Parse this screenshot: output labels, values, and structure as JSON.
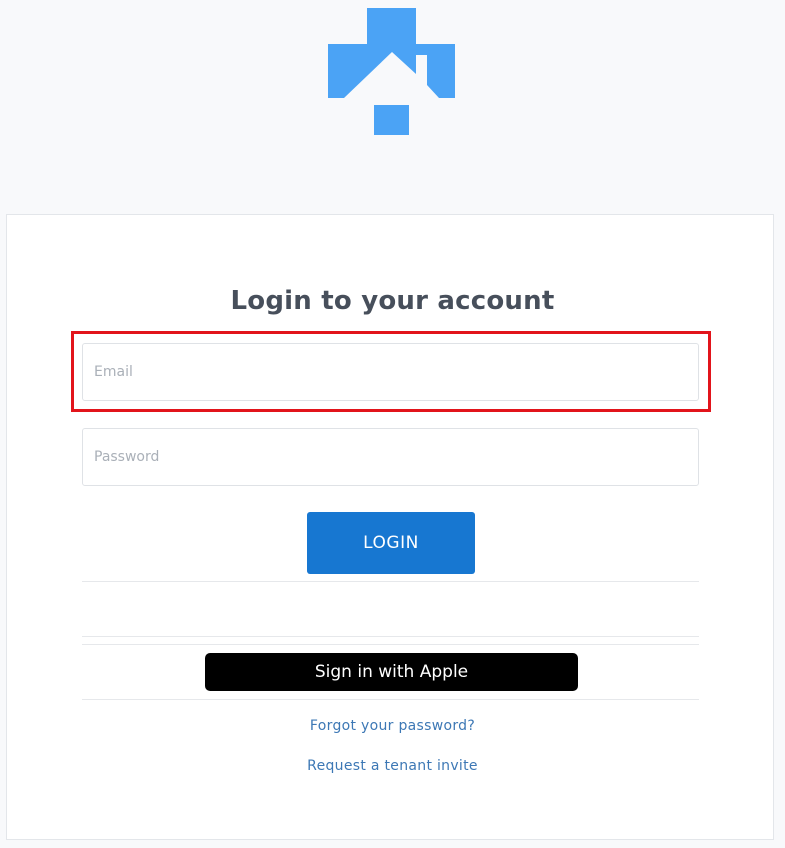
{
  "brand": {
    "logo_icon": "house-cross-logo-icon",
    "accent_color": "#4ba3f5"
  },
  "login": {
    "title": "Login to your account",
    "email_placeholder": "Email",
    "email_value": "",
    "password_placeholder": "Password",
    "password_value": "",
    "login_label": "LOGIN",
    "apple_label": "Sign in with Apple",
    "forgot_label": "Forgot your password?",
    "invite_label": "Request a tenant invite"
  },
  "colors": {
    "primary_button": "#1777d1",
    "link": "#3d78b5",
    "highlight": "#e2141b"
  }
}
